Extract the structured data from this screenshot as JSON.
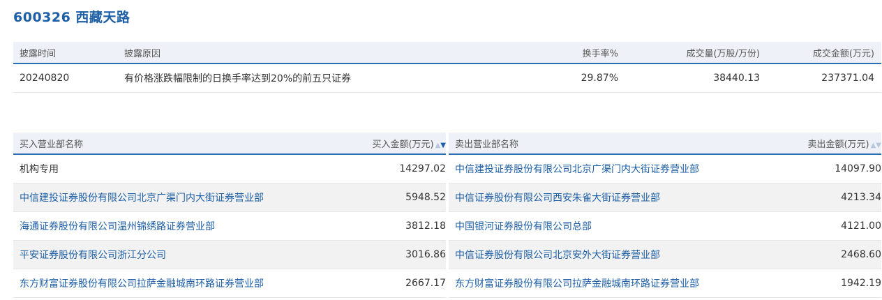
{
  "title": "600326 西藏天路",
  "disclosure": {
    "headers": {
      "date": "披露时间",
      "reason": "披露原因",
      "turnover": "换手率%",
      "volume": "成交量(万股/万份)",
      "amount": "成交金额(万元)"
    },
    "row": {
      "date": "20240820",
      "reason": "有价格涨跌幅限制的日换手率达到20%的前五只证券",
      "turnover": "29.87%",
      "volume": "38440.13",
      "amount": "237371.04"
    }
  },
  "buy": {
    "header_name": "买入营业部名称",
    "header_amount": "买入金额(万元)",
    "rows": [
      {
        "name": "机构专用",
        "amount": "14297.02"
      },
      {
        "name": "中信建投证券股份有限公司北京广渠门内大街证券营业部",
        "amount": "5948.52"
      },
      {
        "name": "海通证券股份有限公司温州锦绣路证券营业部",
        "amount": "3812.18"
      },
      {
        "name": "平安证券股份有限公司浙江分公司",
        "amount": "3016.86"
      },
      {
        "name": "东方财富证券股份有限公司拉萨金融城南环路证券营业部",
        "amount": "2667.17"
      }
    ]
  },
  "sell": {
    "header_name": "卖出营业部名称",
    "header_amount": "卖出金额(万元)",
    "rows": [
      {
        "name": "中信建投证券股份有限公司北京广渠门内大街证券营业部",
        "amount": "14097.90"
      },
      {
        "name": "中信证券股份有限公司西安朱雀大街证券营业部",
        "amount": "4213.34"
      },
      {
        "name": "中国银河证券股份有限公司总部",
        "amount": "4121.00"
      },
      {
        "name": "中信证券股份有限公司北京安外大街证券营业部",
        "amount": "2468.60"
      },
      {
        "name": "东方财富证券股份有限公司拉萨金融城南环路证券营业部",
        "amount": "1942.19"
      }
    ]
  }
}
